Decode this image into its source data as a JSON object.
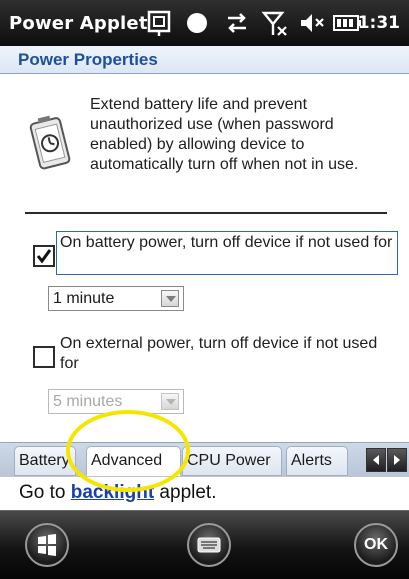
{
  "window": {
    "app_title": "Power Applet",
    "clock": "1:31",
    "status_icons": [
      "device-icon",
      "circle-icon",
      "sync-icon",
      "signal-off-icon",
      "volume-off-icon",
      "battery-icon"
    ]
  },
  "header": {
    "title": "Power Properties"
  },
  "main": {
    "description": "Extend battery life and prevent unauthorized use (when password enabled) by allowing device to automatically turn off when not in use.",
    "battery_option": {
      "label": "On battery power, turn off device if not used for",
      "checked": true,
      "selected": "1 minute"
    },
    "external_option": {
      "label": "On external power, turn off device if not used for",
      "checked": false,
      "selected": "5 minutes"
    }
  },
  "tabs": [
    {
      "label": "Battery",
      "selected": false
    },
    {
      "label": "Advanced",
      "selected": true
    },
    {
      "label": "CPU Power",
      "selected": false
    },
    {
      "label": "Alerts",
      "selected": false
    }
  ],
  "footer": {
    "prefix": "Go to ",
    "link": "backlight",
    "suffix": " applet."
  },
  "softkeys": {
    "start_icon": "windows-start-icon",
    "keyboard_icon": "keyboard-icon",
    "ok_label": "OK"
  },
  "colors": {
    "title_bar": "#1a1a1a",
    "header_text": "#1d4fa0",
    "link": "#1a3fb0",
    "annotation": "#f5e600"
  }
}
